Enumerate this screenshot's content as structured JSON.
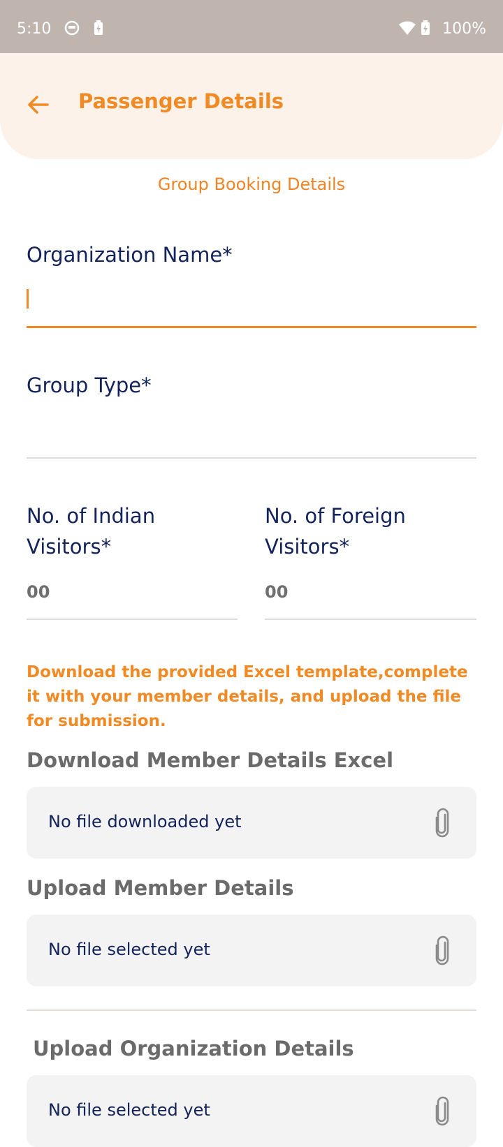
{
  "status_bar": {
    "time": "5:10",
    "battery": "100%"
  },
  "header": {
    "title": "Passenger Details",
    "back_icon": "arrow-left-icon"
  },
  "section_title": "Group Booking Details",
  "form": {
    "organization_name": {
      "label": "Organization Name*",
      "value": ""
    },
    "group_type": {
      "label": "Group Type*",
      "value": ""
    },
    "indian_visitors": {
      "label_line1": "No. of Indian",
      "label_line2": "Visitors*",
      "placeholder": "00"
    },
    "foreign_visitors": {
      "label_line1": "No. of Foreign",
      "label_line2": "Visitors*",
      "placeholder": "00"
    }
  },
  "notice": "Download the provided Excel template,complete it with your member details, and upload the file for submission.",
  "download_section": {
    "heading": "Download Member Details Excel",
    "status": "No file downloaded yet"
  },
  "upload_member_section": {
    "heading": "Upload Member Details",
    "status": "No file selected yet"
  },
  "upload_org_section": {
    "heading": "Upload Organization Details",
    "status": "No file selected yet"
  },
  "colors": {
    "accent": "#f08a24",
    "header_bg": "#fdf2e9",
    "label": "#13235b",
    "status_bar": "#bfb4ae"
  }
}
